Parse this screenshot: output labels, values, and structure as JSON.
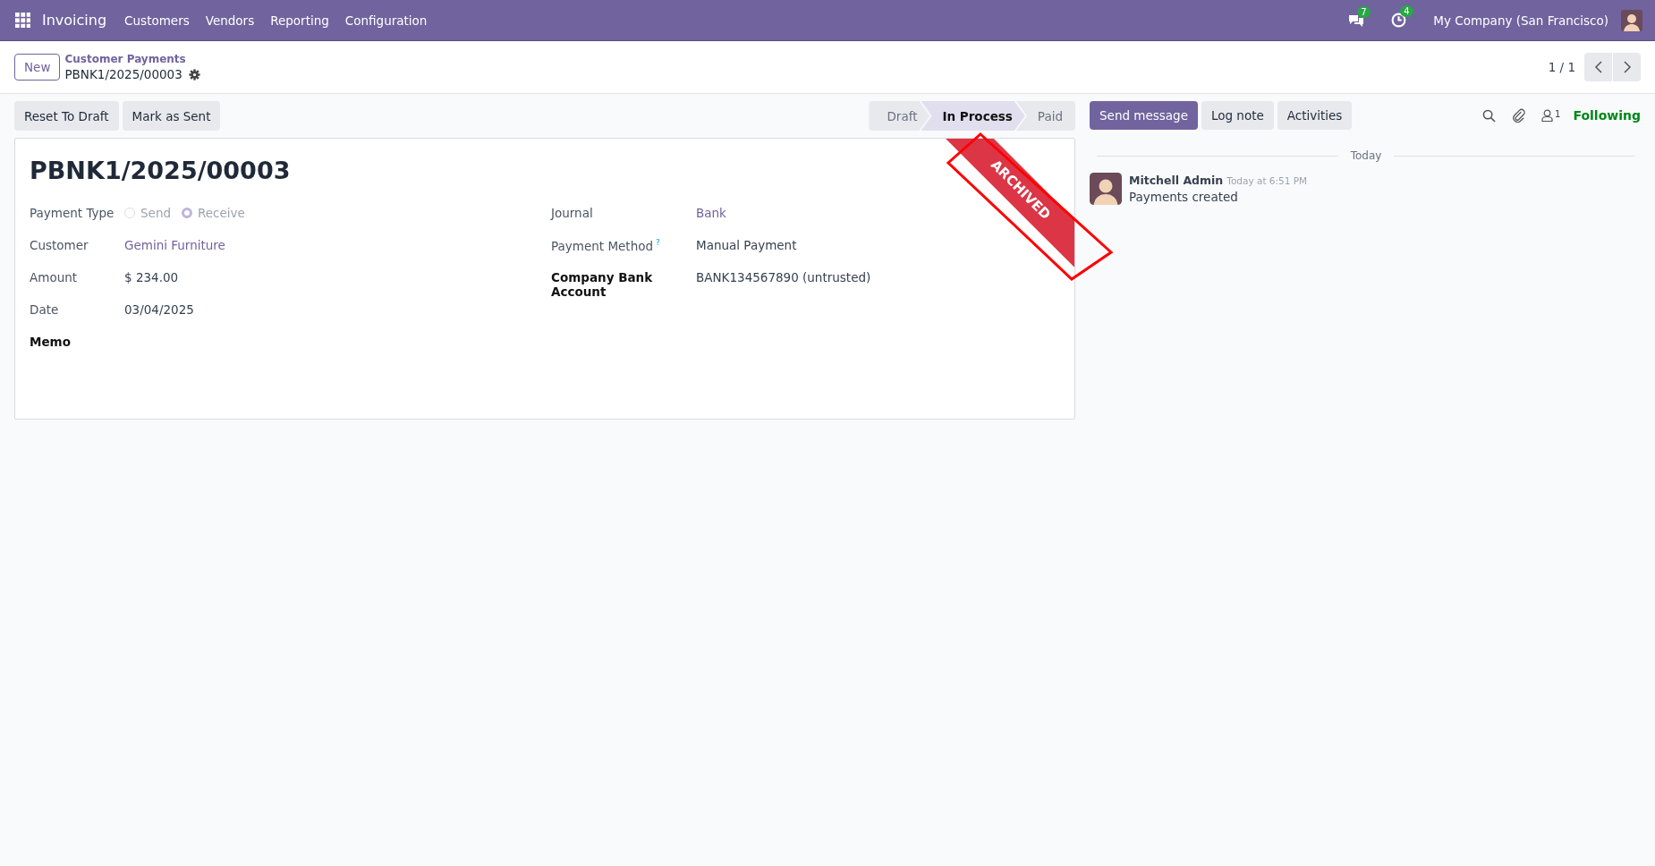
{
  "navbar": {
    "app_name": "Invoicing",
    "menus": [
      "Customers",
      "Vendors",
      "Reporting",
      "Configuration"
    ],
    "messages_count": "7",
    "activities_count": "4",
    "company": "My Company (San Francisco)"
  },
  "control_panel": {
    "new_button": "New",
    "breadcrumb": "Customer Payments",
    "record": "PBNK1/2025/00003",
    "pager": "1 / 1"
  },
  "actions": [
    "Reset To Draft",
    "Mark as Sent"
  ],
  "statusbar": [
    {
      "label": "Draft",
      "selected": false
    },
    {
      "label": "In Process",
      "selected": true
    },
    {
      "label": "Paid",
      "selected": false
    }
  ],
  "ribbon": "ARCHIVED",
  "form": {
    "title": "PBNK1/2025/00003",
    "payment_type": {
      "label": "Payment Type",
      "options": [
        {
          "label": "Send",
          "selected": false
        },
        {
          "label": "Receive",
          "selected": true
        }
      ]
    },
    "left_fields": [
      {
        "label": "Customer",
        "value": "Gemini Furniture",
        "kind": "link"
      },
      {
        "label": "Amount",
        "value": "$ 234.00",
        "kind": "text"
      },
      {
        "label": "Date",
        "value": "03/04/2025",
        "kind": "text"
      },
      {
        "label": "Memo",
        "kind": "required"
      }
    ],
    "right_fields": [
      {
        "label": "Journal",
        "value": "Bank",
        "kind": "link"
      },
      {
        "label": "Payment Method",
        "help": "?",
        "value": "Manual Payment",
        "kind": "text"
      },
      {
        "label": "Company Bank Account",
        "value": "BANK134567890 (untrusted)",
        "kind": "required"
      }
    ]
  },
  "chatter": {
    "buttons": [
      {
        "label": "Send message",
        "selected": true
      },
      {
        "label": "Log note",
        "selected": false
      },
      {
        "label": "Activities",
        "selected": false
      }
    ],
    "followers_count": "1",
    "follow_status": "Following",
    "date_separator": "Today",
    "messages": [
      {
        "author": "Mitchell Admin",
        "time": "Today at 6:51 PM",
        "body": "Payments created"
      }
    ]
  }
}
